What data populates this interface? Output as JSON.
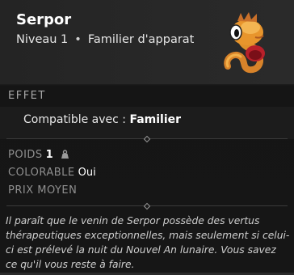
{
  "item": {
    "name": "Serpor",
    "level": "Niveau 1",
    "separator": "•",
    "category": "Familier d'apparat",
    "portrait_icon": "serpor-pet-icon"
  },
  "effet": {
    "section_title": "EFFET",
    "compat_label": "Compatible avec :",
    "compat_value": "Familier"
  },
  "properties": {
    "poids_label": "POIDS",
    "poids_value": "1",
    "poids_icon": "weight-icon",
    "colorable_label": "COLORABLE",
    "colorable_value": "Oui",
    "prix_label": "PRIX MOYEN"
  },
  "description": "Il paraît que le venin de Serpor possède des vertus thérapeutiques exceptionnelles, mais seulement si celui-ci est prélevé la nuit du Nouvel An lunaire. Vous savez ce qu'il vous reste à faire.",
  "colors": {
    "background": "#1a1a1a",
    "header_bg": "#262626",
    "title_text": "#ffffff",
    "label_text": "#8f8f8f",
    "pet_body": "#e0902a",
    "pet_mouth": "#b8202a"
  }
}
